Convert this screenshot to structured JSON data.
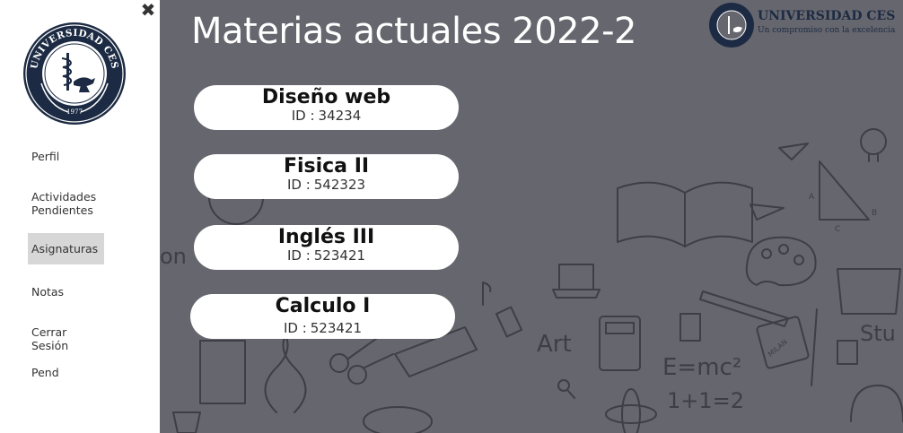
{
  "sidebar": {
    "close_glyph": "✖",
    "seal": {
      "top_text": "UNIVERSIDAD CES",
      "year": "1977"
    },
    "items": [
      {
        "label": "Perfil",
        "active": false
      },
      {
        "label": "Actividades Pendientes",
        "active": false
      },
      {
        "label": "Asignaturas",
        "active": true
      },
      {
        "label": "Notas",
        "active": false
      },
      {
        "label": "Cerrar Sesión",
        "active": false
      },
      {
        "label": "Pend",
        "active": false
      }
    ]
  },
  "main": {
    "title": "Materias actuales 2022-2",
    "brand": {
      "name": "UNIVERSIDAD CES",
      "tagline": "Un compromiso con la excelencia"
    },
    "background_doodles": {
      "art": "Art",
      "formula": "E=mc²",
      "math": "1+1=2",
      "stu": "Stu",
      "on": "on",
      "milan": "MILAN",
      "a": "A",
      "b": "B",
      "c": "C"
    },
    "courses": [
      {
        "name": "Diseño web",
        "id_label": "ID :",
        "id": "34234"
      },
      {
        "name": "Fisica II",
        "id_label": "ID :",
        "id": "542323"
      },
      {
        "name": "Inglés III",
        "id_label": "ID :",
        "id": "523421"
      },
      {
        "name": "Calculo I",
        "id_label": "ID :",
        "id": "523421"
      }
    ]
  },
  "colors": {
    "main_bg": "#66666e",
    "navy": "#1c2b43",
    "active_nav": "#d7d7d7",
    "card_bg": "#ffffff"
  }
}
